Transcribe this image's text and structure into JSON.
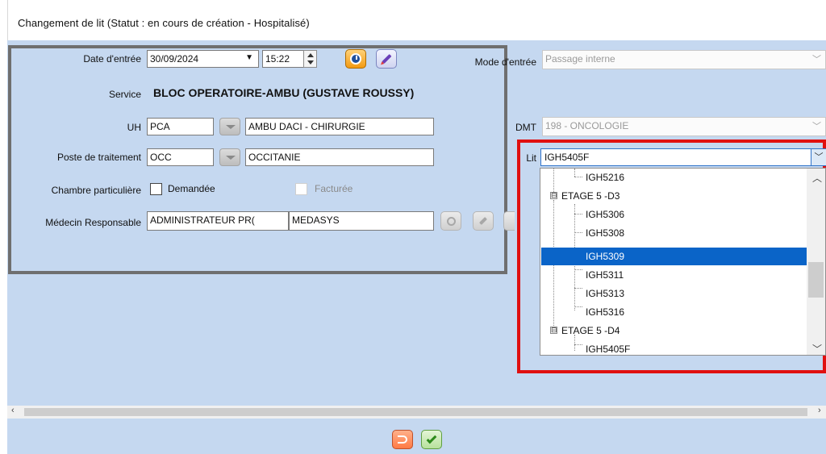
{
  "window": {
    "title": "Changement de lit (Statut : en cours de création - Hospitalisé)"
  },
  "form": {
    "date_label": "Date d'entrée",
    "date_value": "30/09/2024",
    "date_dropdown_glyph": "▼",
    "time_value": "15:22",
    "service_label": "Service",
    "service_value": "BLOC OPERATOIRE-AMBU (GUSTAVE ROUSSY)",
    "uh_label": "UH",
    "uh_code": "PCA",
    "uh_name": "AMBU DACI - CHIRURGIE",
    "poste_label": "Poste de traitement",
    "poste_code": "OCC",
    "poste_name": "OCCITANIE",
    "chambre_label": "Chambre particulière",
    "demandee_label": "Demandée",
    "facturee_label": "Facturée",
    "medecin_label": "Médecin Responsable",
    "medecin_name": "ADMINISTRATEUR PR(",
    "medecin_org": "MEDASYS",
    "mode_label": "Mode d'entrée",
    "mode_value": "Passage interne",
    "dmt_label": "DMT",
    "dmt_value": "198 - ONCOLOGIE",
    "lit_label": "Lit",
    "lit_value": "IGH5405F"
  },
  "tree": {
    "items": [
      {
        "label": "IGH5216",
        "type": "leaf"
      },
      {
        "label": "ETAGE 5 -D3",
        "type": "group",
        "expander": "⊟"
      },
      {
        "label": "IGH5306",
        "type": "leaf"
      },
      {
        "label": "IGH5308",
        "type": "leaf"
      },
      {
        "label": "IGH5309",
        "type": "leaf",
        "selected": true
      },
      {
        "label": "IGH5311",
        "type": "leaf"
      },
      {
        "label": "IGH5313",
        "type": "leaf"
      },
      {
        "label": "IGH5316",
        "type": "leaf"
      },
      {
        "label": "ETAGE 5 -D4",
        "type": "group",
        "expander": "⊟"
      },
      {
        "label": "IGH5405F",
        "type": "leaf"
      }
    ]
  },
  "colors": {
    "form_bg": "#c5d8f0",
    "selection": "#0a64c8",
    "highlight_frame": "#e01010",
    "group_frame": "#6f6f6f"
  },
  "icons": {
    "clock": "clock-icon",
    "edit": "pencil-icon",
    "search": "search-icon",
    "undo": "undo-icon",
    "validate": "check-icon",
    "chevron": "chevron-down-icon"
  }
}
